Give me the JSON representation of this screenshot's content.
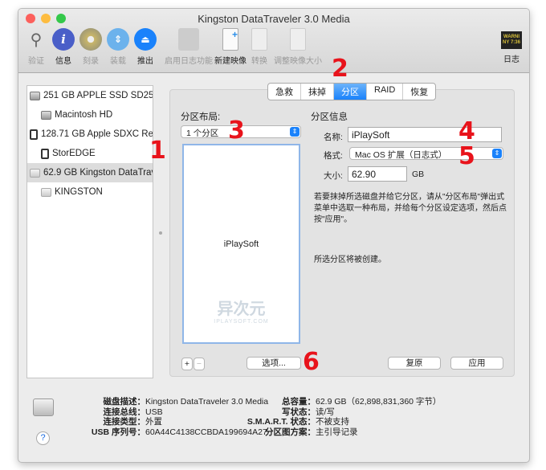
{
  "window": {
    "title": "Kingston DataTraveler 3.0 Media"
  },
  "toolbar": [
    {
      "label": "验证",
      "icon": "microscope-icon",
      "enabled": false
    },
    {
      "label": "信息",
      "icon": "info-icon",
      "enabled": true
    },
    {
      "label": "刻录",
      "icon": "burn-icon",
      "enabled": false
    },
    {
      "label": "装载",
      "icon": "mount-icon",
      "enabled": false
    },
    {
      "label": "推出",
      "icon": "eject-icon",
      "enabled": true
    },
    {
      "label": "启用日志功能",
      "icon": "journal-icon",
      "enabled": false
    },
    {
      "label": "新建映像",
      "icon": "new-image-icon",
      "enabled": true
    },
    {
      "label": "转换",
      "icon": "convert-icon",
      "enabled": false
    },
    {
      "label": "调整映像大小",
      "icon": "resize-image-icon",
      "enabled": false
    }
  ],
  "log_button": {
    "label": "日志",
    "badge": "WARNI NY 7:36"
  },
  "sidebar": {
    "items": [
      {
        "label": "251 GB APPLE SSD SD256.",
        "indent": false,
        "icon": "hard-disk-icon"
      },
      {
        "label": "Macintosh HD",
        "indent": true,
        "icon": "hard-disk-icon"
      },
      {
        "label": "128.71 GB Apple SDXC Re.",
        "indent": false,
        "icon": "sd-card-icon"
      },
      {
        "label": "StorEDGE",
        "indent": true,
        "icon": "sd-card-icon"
      },
      {
        "label": "62.9 GB Kingston DataTrav.",
        "indent": false,
        "icon": "usb-disk-icon",
        "selected": true
      },
      {
        "label": "KINGSTON",
        "indent": true,
        "icon": "usb-disk-icon"
      }
    ]
  },
  "tabs": [
    {
      "label": "急救"
    },
    {
      "label": "抹掉"
    },
    {
      "label": "分区",
      "active": true
    },
    {
      "label": "RAID"
    },
    {
      "label": "恢复"
    }
  ],
  "partition": {
    "layout_label": "分区布局:",
    "layout_value": "1 个分区",
    "partition_name": "iPlaySoft",
    "info_label": "分区信息",
    "name_label": "名称:",
    "name_value": "iPlaySoft",
    "format_label": "格式:",
    "format_value": "Mac OS 扩展（日志式）",
    "size_label": "大小:",
    "size_value": "62.90",
    "size_unit": "GB",
    "description": "若要抹掉所选磁盘并给它分区，请从\"分区布局\"弹出式菜单中选取一种布局，并给每个分区设定选项，然后点按\"应用\"。",
    "status": "所选分区将被创建。",
    "add": "+",
    "remove": "−",
    "options": "选项...",
    "revert": "复原",
    "apply": "应用"
  },
  "watermark": {
    "logo": "异次元",
    "url": "IPLAYSOFT.COM"
  },
  "annotations": [
    "1",
    "2",
    "3",
    "4",
    "5",
    "6"
  ],
  "details": {
    "left": [
      {
        "k": "磁盘描述：",
        "v": "Kingston DataTraveler 3.0 Media"
      },
      {
        "k": "连接总线：",
        "v": "USB"
      },
      {
        "k": "连接类型：",
        "v": "外置"
      },
      {
        "k": "USB 序列号：",
        "v": "60A44C4138CCBDA199694A27"
      }
    ],
    "right": [
      {
        "k": "总容量：",
        "v": "62.9 GB（62,898,831,360 字节）"
      },
      {
        "k": "写状态：",
        "v": "读/写"
      },
      {
        "k": "S.M.A.R.T. 状态：",
        "v": "不被支持"
      },
      {
        "k": "分区图方案：",
        "v": "主引导记录"
      }
    ]
  },
  "help": "?"
}
